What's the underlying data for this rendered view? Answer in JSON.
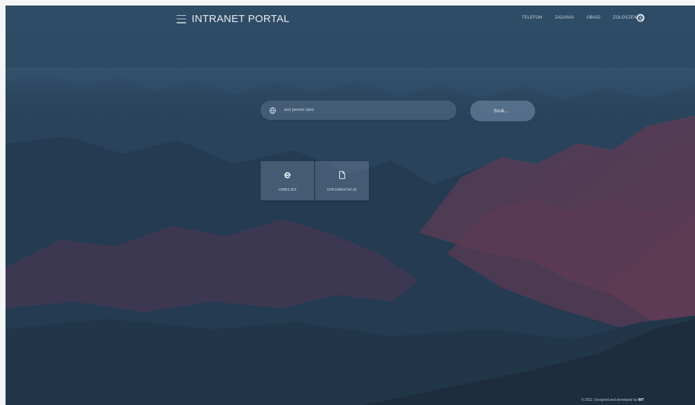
{
  "header": {
    "brand_title": "INTRANET PORTAL",
    "nav": [
      {
        "label": "TELEFON"
      },
      {
        "label": "ZADANIA"
      },
      {
        "label": "OBIAD"
      },
      {
        "label": "ZGŁOSZENIA"
      }
    ],
    "lang_icon": "browser-e-icon"
  },
  "search": {
    "placeholder": "Jest pewne takie",
    "value": "",
    "button_label": "Szuk...",
    "icon": "search-globe-icon"
  },
  "tiles": [
    {
      "label": "URBIS.BIZ",
      "icon": "browser-e-icon"
    },
    {
      "label": "DOKUMENTACJE",
      "icon": "document-icon"
    }
  ],
  "footer": {
    "text": "© 2022. Designed and developed by",
    "author": "IMT"
  },
  "colors": {
    "sky": "#2b4760",
    "mountain_dark": "#1f3447",
    "mountain_red": "#5a3b52",
    "text_light": "#e9eef3"
  }
}
